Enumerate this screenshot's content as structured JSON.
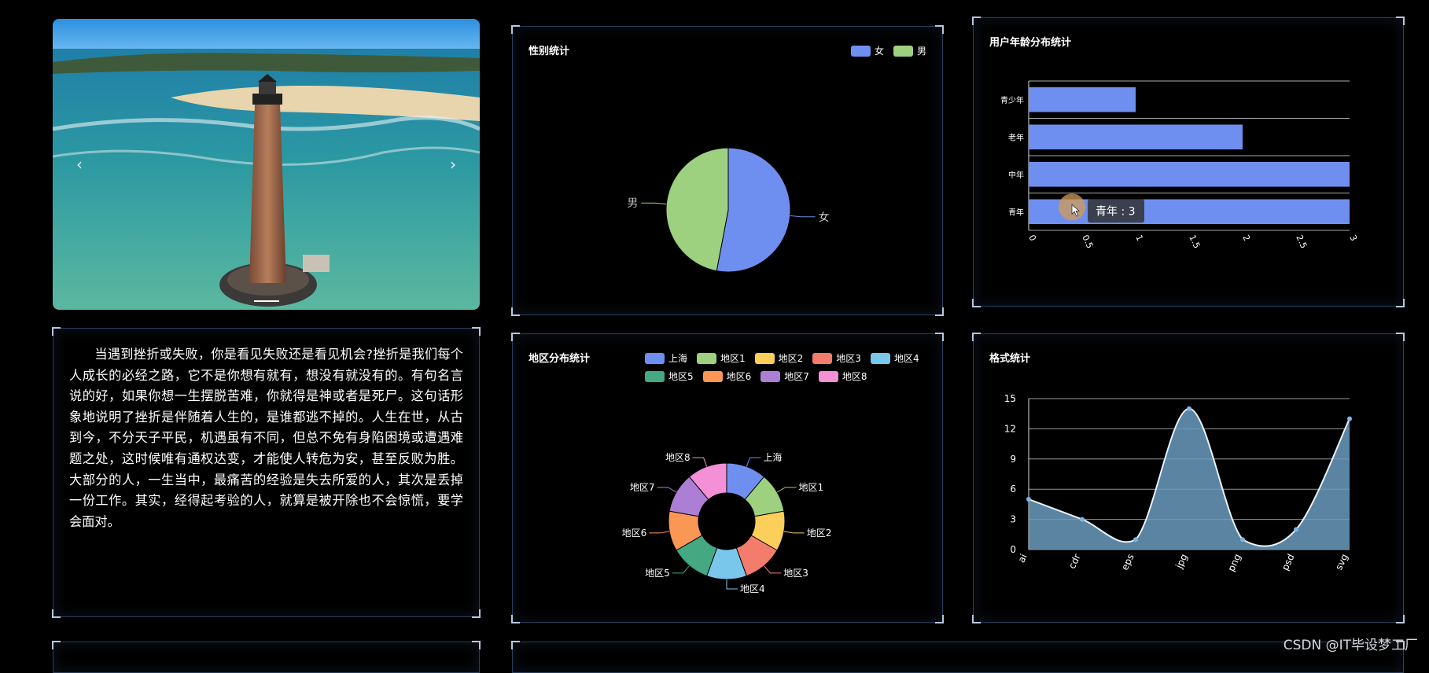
{
  "carousel": {
    "prev_icon": "‹",
    "next_icon": "›",
    "image_desc_icon": "lighthouse-photo"
  },
  "article": {
    "text": "当遇到挫折或失败，你是看见失败还是看见机会?挫折是我们每个人成长的必经之路，它不是你想有就有，想没有就没有的。有句名言说的好，如果你想一生摆脱苦难，你就得是神或者是死尸。这句话形象地说明了挫折是伴随着人生的，是谁都逃不掉的。人生在世，从古到今，不分天子平民，机遇虽有不同，但总不免有身陷困境或遭遇难题之处，这时候唯有通权达变，才能使人转危为安，甚至反败为胜。大部分的人，一生当中，最痛苦的经验是失去所爱的人，其次是丢掉一份工作。其实，经得起考验的人，就算是被开除也不会惊慌，要学会面对。"
  },
  "gender": {
    "title": "性别统计",
    "legend": [
      {
        "label": "女",
        "color": "#6f8ff0"
      },
      {
        "label": "男",
        "color": "#9dd07f"
      }
    ]
  },
  "age": {
    "title": "用户年龄分布统计",
    "tooltip": "青年 : 3"
  },
  "region": {
    "title": "地区分布统计",
    "legend": [
      {
        "label": "上海",
        "color": "#6f8ff0"
      },
      {
        "label": "地区1",
        "color": "#9dd07f"
      },
      {
        "label": "地区2",
        "color": "#fccf5a"
      },
      {
        "label": "地区3",
        "color": "#f47c6c"
      },
      {
        "label": "地区4",
        "color": "#79c8ec"
      },
      {
        "label": "地区5",
        "color": "#44a882"
      },
      {
        "label": "地区6",
        "color": "#fb9754"
      },
      {
        "label": "地区7",
        "color": "#ad7fd4"
      },
      {
        "label": "地区8",
        "color": "#f490d6"
      }
    ]
  },
  "format": {
    "title": "格式统计"
  },
  "watermark": "CSDN @IT毕设梦工厂",
  "chart_data": [
    {
      "type": "pie",
      "categories": [
        "女",
        "男"
      ],
      "values": [
        53,
        47
      ],
      "legend_position": "top-right"
    },
    {
      "type": "bar",
      "orientation": "horizontal",
      "categories": [
        "青少年",
        "老年",
        "中年",
        "青年"
      ],
      "values": [
        1,
        2,
        3,
        3
      ],
      "xlim": [
        0,
        3
      ],
      "xticks": [
        "0",
        "0.5",
        "1",
        "1.5",
        "2",
        "2.5",
        "3"
      ],
      "grid": true
    },
    {
      "type": "pie",
      "style": "donut",
      "categories": [
        "上海",
        "地区1",
        "地区2",
        "地区3",
        "地区4",
        "地区5",
        "地区6",
        "地区7",
        "地区8"
      ],
      "values": [
        1,
        1,
        1,
        1,
        1,
        1,
        1,
        1,
        1
      ],
      "legend_position": "top"
    },
    {
      "type": "area",
      "smooth": true,
      "categories": [
        "ai",
        "cdr",
        "eps",
        "jpg",
        "png",
        "psd",
        "svg"
      ],
      "values": [
        5,
        3,
        1,
        14,
        1,
        2,
        13
      ],
      "ylim": [
        0,
        15
      ],
      "yticks": [
        "0",
        "3",
        "6",
        "9",
        "12",
        "15"
      ],
      "grid": true
    }
  ]
}
